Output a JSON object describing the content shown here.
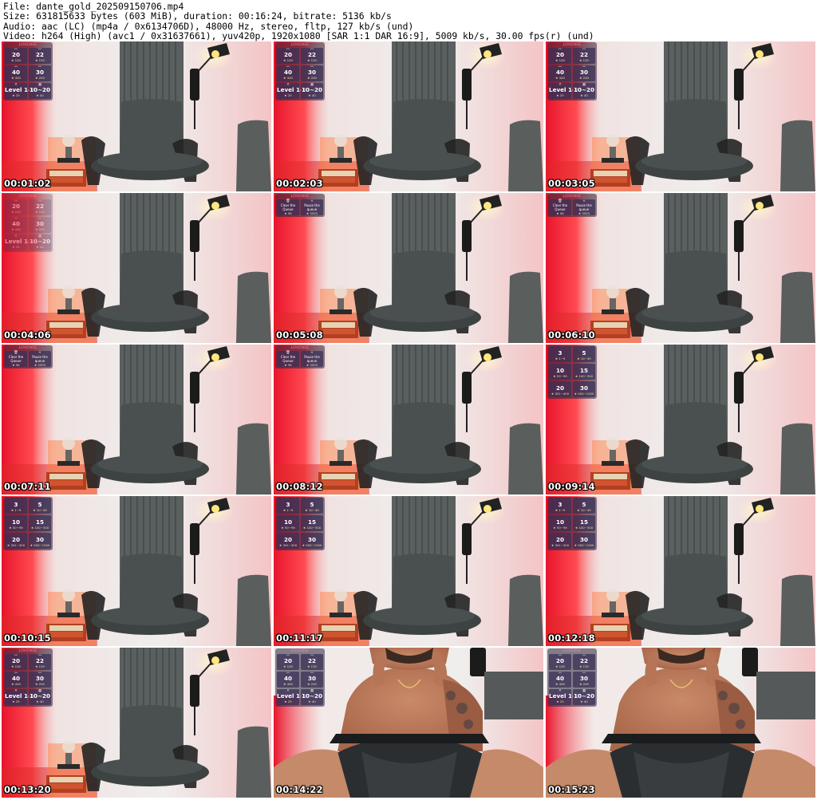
{
  "header": {
    "file_line": "File: dante_gold_202509150706.mp4",
    "size_line": "Size: 631815633 bytes (603 MiB), duration: 00:16:24, bitrate: 5136 kb/s",
    "audio_line": "Audio: aac (LC) (mp4a / 0x6134706D), 48000 Hz, stereo, fltp, 127 kb/s (und)",
    "video_line": "Video: h264 (High) (avc1 / 0x31637661), yuv420p, 1920x1080 [SAR 1:1 DAR 16:9], 5009 kb/s, 30.00 fps(r) (und)"
  },
  "overlay_panels": {
    "brand": "LOVENSE",
    "levels": [
      {
        "icon": "〰",
        "value": "20",
        "range": "★ 100"
      },
      {
        "icon": "〰",
        "value": "22",
        "range": "★ 150"
      },
      {
        "icon": "〰",
        "value": "40",
        "range": "★ 400"
      },
      {
        "icon": "〰",
        "value": "30",
        "range": "★ 200"
      },
      {
        "icon": "✕",
        "value": "Level 1-4",
        "range": "★ 25"
      },
      {
        "icon": "▦",
        "value": "10~20",
        "range": "★ 40"
      }
    ],
    "queue": [
      {
        "icon": "🗑",
        "value": "Clear the Queue",
        "range": "★ 5K"
      },
      {
        "icon": "⏸",
        "value": "Pause the queue",
        "range": "★ 5555"
      }
    ],
    "tips": [
      {
        "icon": "",
        "value": "3",
        "range": "★ 1~9"
      },
      {
        "icon": "",
        "value": "5",
        "range": "★ 10~49"
      },
      {
        "icon": "",
        "value": "10",
        "range": "★ 50~99"
      },
      {
        "icon": "",
        "value": "15",
        "range": "★ 100~300"
      },
      {
        "icon": "",
        "value": "20",
        "range": "★ 301~400"
      },
      {
        "icon": "",
        "value": "30",
        "range": "★ 500~1000"
      }
    ]
  },
  "thumbnails": [
    {
      "time": "00:01:02",
      "scene": "chair",
      "overlay": "levels"
    },
    {
      "time": "00:02:03",
      "scene": "chair",
      "overlay": "levels"
    },
    {
      "time": "00:03:05",
      "scene": "chair",
      "overlay": "levels"
    },
    {
      "time": "00:04:06",
      "scene": "chair",
      "overlay": "levels-fade"
    },
    {
      "time": "00:05:08",
      "scene": "chair",
      "overlay": "queue"
    },
    {
      "time": "00:06:10",
      "scene": "chair",
      "overlay": "queue"
    },
    {
      "time": "00:07:11",
      "scene": "chair",
      "overlay": "queue"
    },
    {
      "time": "00:08:12",
      "scene": "chair",
      "overlay": "queue"
    },
    {
      "time": "00:09:14",
      "scene": "chair",
      "overlay": "tips"
    },
    {
      "time": "00:10:15",
      "scene": "chair",
      "overlay": "tips"
    },
    {
      "time": "00:11:17",
      "scene": "chair",
      "overlay": "tips"
    },
    {
      "time": "00:12:18",
      "scene": "chair",
      "overlay": "tips"
    },
    {
      "time": "00:13:20",
      "scene": "chair",
      "overlay": "levels"
    },
    {
      "time": "00:14:22",
      "scene": "person",
      "overlay": "levels"
    },
    {
      "time": "00:15:23",
      "scene": "person",
      "overlay": "levels"
    }
  ],
  "colors": {
    "wall": "#ebe9e6",
    "red_glow": "#e8283c",
    "chair": "#4a504f",
    "panel": "#2a2440"
  }
}
